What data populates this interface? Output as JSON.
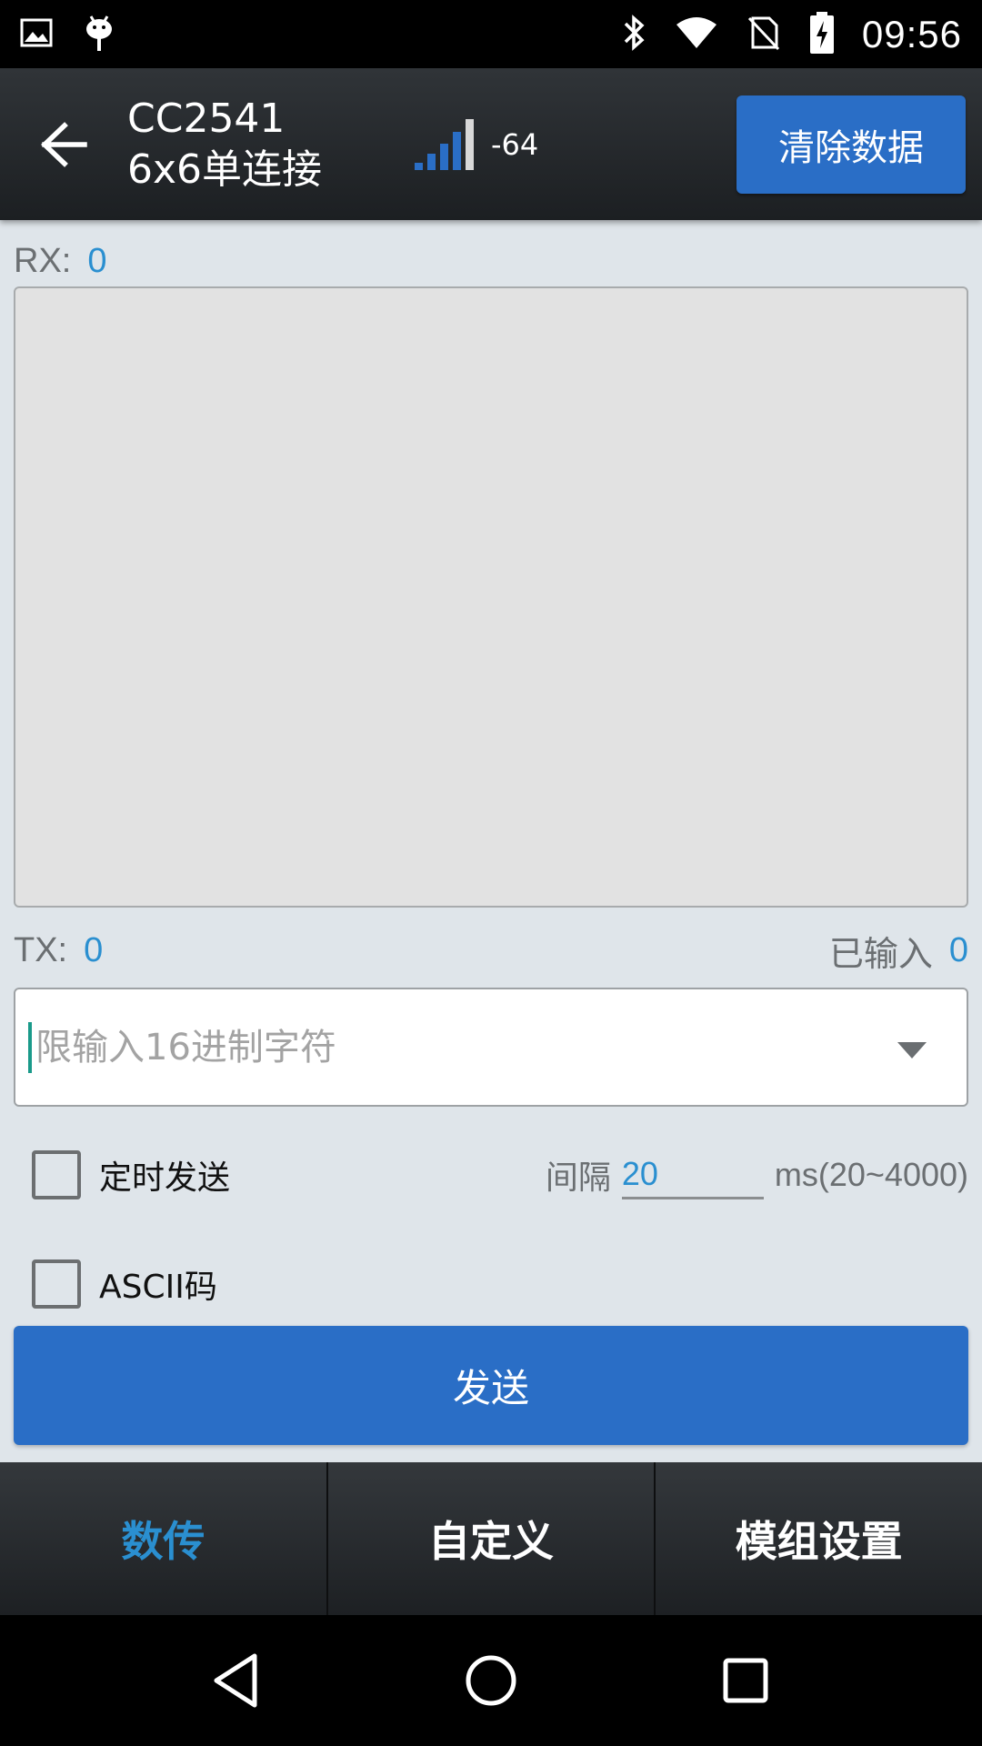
{
  "status_bar": {
    "time": "09:56",
    "icons_left": [
      "image-icon",
      "android-debug-icon"
    ],
    "icons_right": [
      "bluetooth-icon",
      "wifi-icon",
      "no-sim-icon",
      "battery-charging-icon"
    ]
  },
  "header": {
    "device_name": "CC2541",
    "device_subtitle": "6x6单连接",
    "rssi": "-64",
    "clear_button": "清除数据"
  },
  "rx": {
    "label": "RX:",
    "count": "0"
  },
  "tx": {
    "label": "TX:",
    "count": "0",
    "entered_label": "已输入",
    "entered_count": "0"
  },
  "input": {
    "placeholder": "限输入16进制字符",
    "value": ""
  },
  "timer": {
    "label": "定时发送",
    "checked": false,
    "interval_label": "间隔",
    "interval_value": "20",
    "unit": "ms(20~4000)"
  },
  "ascii": {
    "label": "ASCII码",
    "checked": false
  },
  "send_button": "发送",
  "tabs": [
    {
      "label": "数传",
      "active": true
    },
    {
      "label": "自定义",
      "active": false
    },
    {
      "label": "模组设置",
      "active": false
    }
  ],
  "colors": {
    "accent": "#2a6ec6",
    "value_blue": "#2a8fd0",
    "background": "#dfe5ea"
  }
}
